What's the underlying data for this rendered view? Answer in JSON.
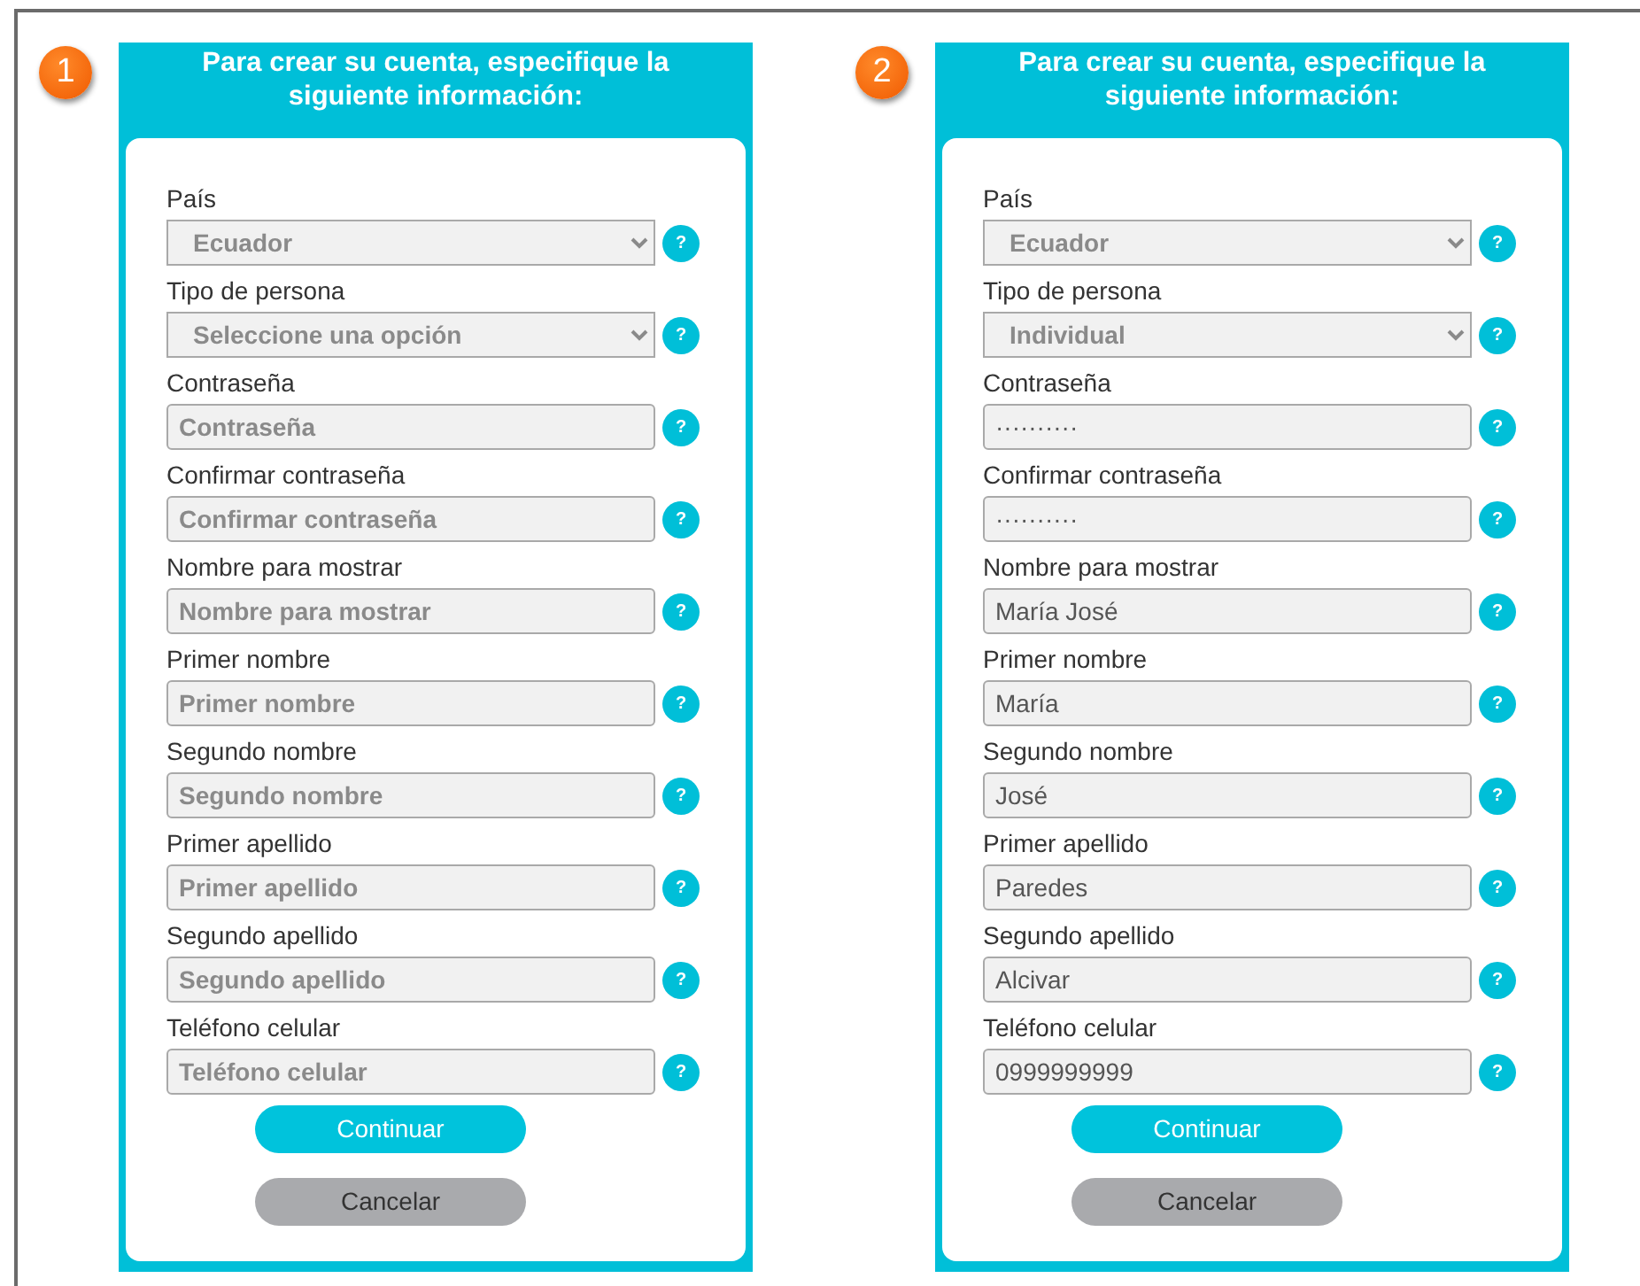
{
  "forms": [
    {
      "step": "1",
      "title": "Para crear su cuenta, especifique la siguiente información:",
      "fields": [
        {
          "kind": "select",
          "label": "País",
          "value": "Ecuador",
          "help": "?"
        },
        {
          "kind": "select",
          "label": "Tipo de persona",
          "value": "Seleccione una opción",
          "help": "?"
        },
        {
          "kind": "input",
          "label": "Contraseña",
          "placeholder": "Contraseña",
          "help": "?"
        },
        {
          "kind": "input",
          "label": "Confirmar contraseña",
          "placeholder": "Confirmar contraseña",
          "help": "?"
        },
        {
          "kind": "input",
          "label": "Nombre para mostrar",
          "placeholder": "Nombre para mostrar",
          "help": "?"
        },
        {
          "kind": "input",
          "label": "Primer nombre",
          "placeholder": "Primer nombre",
          "help": "?"
        },
        {
          "kind": "input",
          "label": "Segundo nombre",
          "placeholder": "Segundo nombre",
          "help": "?"
        },
        {
          "kind": "input",
          "label": "Primer apellido",
          "placeholder": "Primer apellido",
          "help": "?"
        },
        {
          "kind": "input",
          "label": "Segundo apellido",
          "placeholder": "Segundo apellido",
          "help": "?"
        },
        {
          "kind": "input",
          "label": "Teléfono celular",
          "placeholder": "Teléfono celular",
          "help": "?"
        }
      ],
      "buttons": [
        {
          "kind": "primary",
          "label": "Continuar"
        },
        {
          "kind": "secondary",
          "label": "Cancelar"
        }
      ]
    },
    {
      "step": "2",
      "title": "Para crear su cuenta, especifique la siguiente información:",
      "fields": [
        {
          "kind": "select",
          "label": "País",
          "value": "Ecuador",
          "help": "?"
        },
        {
          "kind": "select",
          "label": "Tipo de persona",
          "value": "Individual",
          "help": "?"
        },
        {
          "kind": "input",
          "label": "Contraseña",
          "value": "··········",
          "help": "?"
        },
        {
          "kind": "input",
          "label": "Confirmar contraseña",
          "value": "··········",
          "help": "?"
        },
        {
          "kind": "input",
          "label": "Nombre para mostrar",
          "value": "María José",
          "help": "?"
        },
        {
          "kind": "input",
          "label": "Primer nombre",
          "value": "María",
          "help": "?"
        },
        {
          "kind": "input",
          "label": "Segundo nombre",
          "value": "José",
          "help": "?"
        },
        {
          "kind": "input",
          "label": "Primer apellido",
          "value": "Paredes",
          "help": "?"
        },
        {
          "kind": "input",
          "label": "Segundo apellido",
          "value": "Alcivar",
          "help": "?"
        },
        {
          "kind": "input",
          "label": "Teléfono celular",
          "value": "0999999999",
          "help": "?"
        }
      ],
      "buttons": [
        {
          "kind": "primary",
          "label": "Continuar"
        },
        {
          "kind": "secondary",
          "label": "Cancelar"
        }
      ]
    }
  ]
}
